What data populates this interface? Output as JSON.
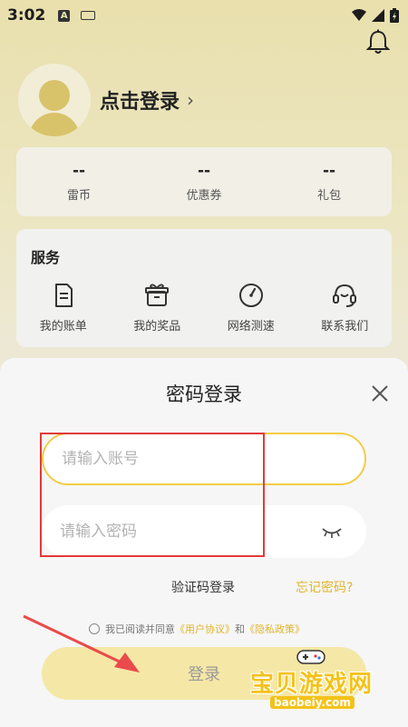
{
  "status_bar": {
    "time": "3:02",
    "a_badge": "A"
  },
  "profile": {
    "login_text": "点击登录",
    "chevron": "›"
  },
  "stats": [
    {
      "value": "--",
      "label": "雷币"
    },
    {
      "value": "--",
      "label": "优惠券"
    },
    {
      "value": "--",
      "label": "礼包"
    }
  ],
  "services": {
    "title": "服务",
    "items": [
      {
        "label": "我的账单",
        "icon": "bill-icon"
      },
      {
        "label": "我的奖品",
        "icon": "prize-icon"
      },
      {
        "label": "网络测速",
        "icon": "speedometer-icon"
      },
      {
        "label": "联系我们",
        "icon": "headset-icon"
      }
    ]
  },
  "login_sheet": {
    "title": "密码登录",
    "account_placeholder": "请输入账号",
    "password_placeholder": "请输入密码",
    "sms_login": "验证码登录",
    "forgot_password": "忘记密码?",
    "agreement_prefix": "我已阅读并同意",
    "user_agreement": "《用户协议》",
    "and": "和",
    "privacy_policy": "《隐私政策》",
    "submit_label": "登录"
  },
  "watermark": {
    "text": "宝贝游戏网",
    "url": "baobeiy.com"
  },
  "colors": {
    "accent": "#f2cd45",
    "link": "#e0b52d",
    "highlight": "#e23a3a",
    "button_bg": "#f5e7a6"
  }
}
